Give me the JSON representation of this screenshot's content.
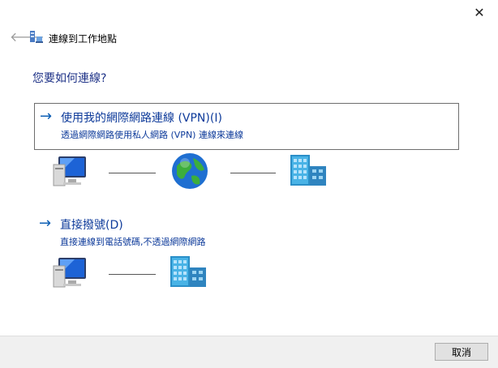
{
  "window": {
    "close_glyph": "✕"
  },
  "header": {
    "back_glyph": "🡐",
    "title": "連線到工作地點"
  },
  "main": {
    "question": "您要如何連線?",
    "options": [
      {
        "title": "使用我的網際網路連線 (VPN)(I)",
        "description": "透過網際網路使用私人網路 (VPN) 連線來連線",
        "arrow_glyph": "→"
      },
      {
        "title": "直接撥號(D)",
        "description": "直接連線到電話號碼,不透過網際網路",
        "arrow_glyph": "→"
      }
    ],
    "icons": {
      "computer": "computer-icon",
      "globe": "globe-icon",
      "building": "office-building-icon"
    }
  },
  "footer": {
    "cancel_label": "取消"
  },
  "colors": {
    "link": "#0d3a9a",
    "arrow": "#0d5fb4",
    "question": "#1e3287",
    "footer_bg": "#f0f0f0"
  }
}
